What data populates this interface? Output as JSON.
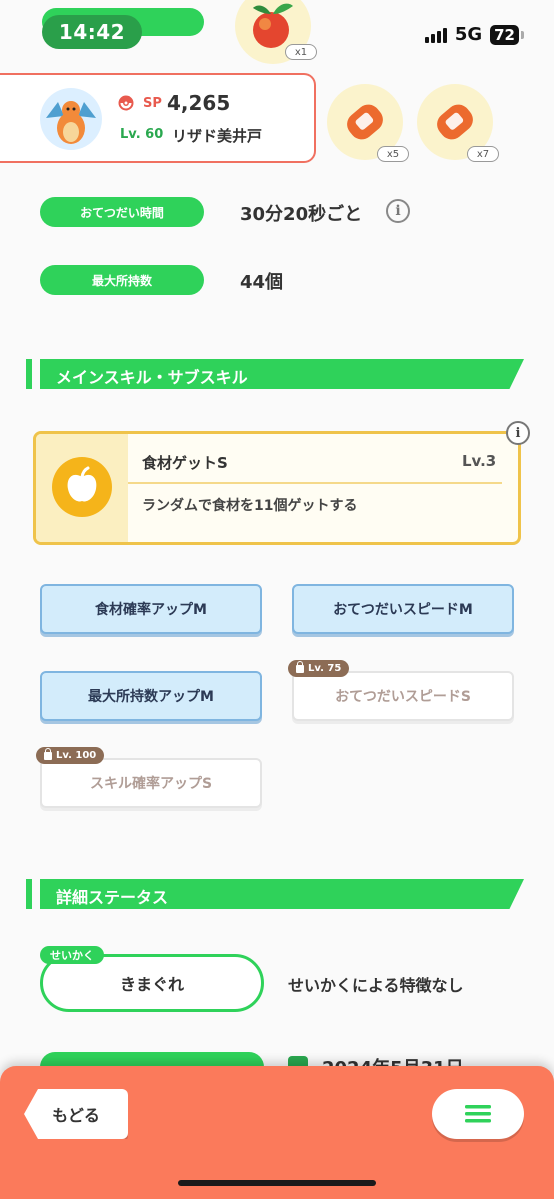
{
  "status_bar": {
    "time": "14:42",
    "network": "5G",
    "battery": "72"
  },
  "header": {
    "pokemon_name": "リザド美井戸",
    "level_prefix": "Lv.",
    "level": "60",
    "sp_label": "SP",
    "sp_value": "4,265"
  },
  "foods": [
    {
      "icon": "apple-food-icon",
      "qty": "x1"
    },
    {
      "icon": "sausage-food-icon",
      "qty": "x5"
    },
    {
      "icon": "sausage-food-icon",
      "qty": "x7"
    }
  ],
  "stats": {
    "help_time_label": "おてつだい時間",
    "help_time_value": "30分20秒ごと",
    "max_carry_label": "最大所持数",
    "max_carry_value": "44個"
  },
  "skills_section": {
    "title": "メインスキル・サブスキル",
    "main_skill": {
      "name": "食材ゲットS",
      "level": "Lv.3",
      "description": "ランダムで食材を11個ゲットする"
    },
    "sub_skills": [
      {
        "label": "食材確率アップM",
        "locked": false
      },
      {
        "label": "おてつだいスピードM",
        "locked": false
      },
      {
        "label": "最大所持数アップM",
        "locked": false
      },
      {
        "label": "おてつだいスピードS",
        "locked": true,
        "unlock": "Lv. 75"
      },
      {
        "label": "スキル確率アップS",
        "locked": true,
        "unlock": "Lv. 100"
      }
    ]
  },
  "details_section": {
    "title": "詳細ステータス",
    "nature_tag": "せいかく",
    "nature": "きまぐれ",
    "nature_desc": "せいかくによる特徴なし",
    "date_partial": "2024年5月31日"
  },
  "bottom_bar": {
    "back_label": "もどる"
  },
  "colors": {
    "accent_green": "#2fd25a",
    "accent_orange": "#fb7a5b",
    "gold": "#efc34a"
  }
}
